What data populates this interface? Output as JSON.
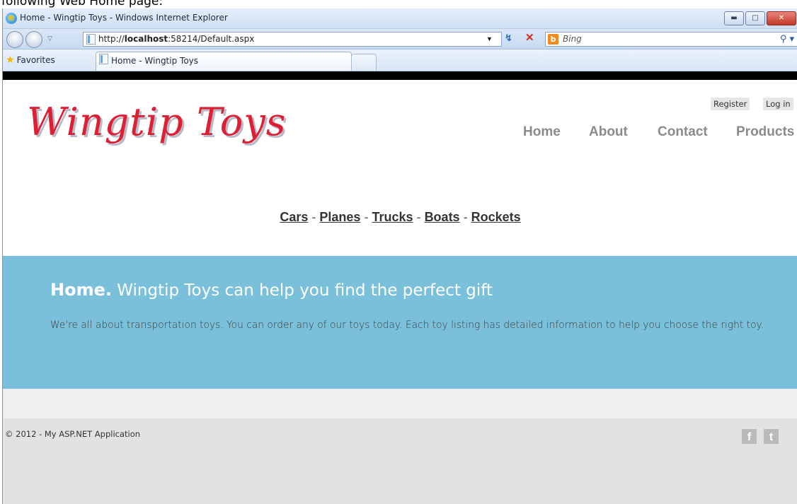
{
  "caption": "following Web Home page:",
  "browser": {
    "title": "Home - Wingtip Toys - Windows Internet Explorer",
    "url_prefix": "http://",
    "url_host": "localhost",
    "url_rest": ":58214/Default.aspx",
    "search_provider": "Bing",
    "favorites_label": "Favorites",
    "tab_label": "Home - Wingtip Toys"
  },
  "site": {
    "logo": "Wingtip Toys",
    "login_links": {
      "register": "Register",
      "login": "Log in"
    },
    "nav": [
      "Home",
      "About",
      "Contact",
      "Products"
    ],
    "categories": [
      "Cars",
      "Planes",
      "Trucks",
      "Boats",
      "Rockets"
    ],
    "category_separator": "-",
    "hero": {
      "title_bold": "Home.",
      "title_rest": "Wingtip Toys can help you find the perfect gift",
      "body": "We're all about transportation toys. You can order any of our toys today. Each toy listing has detailed information to help you choose the right toy."
    },
    "footer": {
      "copyright": "© 2012 - My ASP.NET Application",
      "social": [
        "f",
        "t"
      ]
    }
  },
  "colors": {
    "hero_bg": "#7ac0da",
    "logo_red": "#dc1f33",
    "footer_bg": "#e2e2e2"
  }
}
